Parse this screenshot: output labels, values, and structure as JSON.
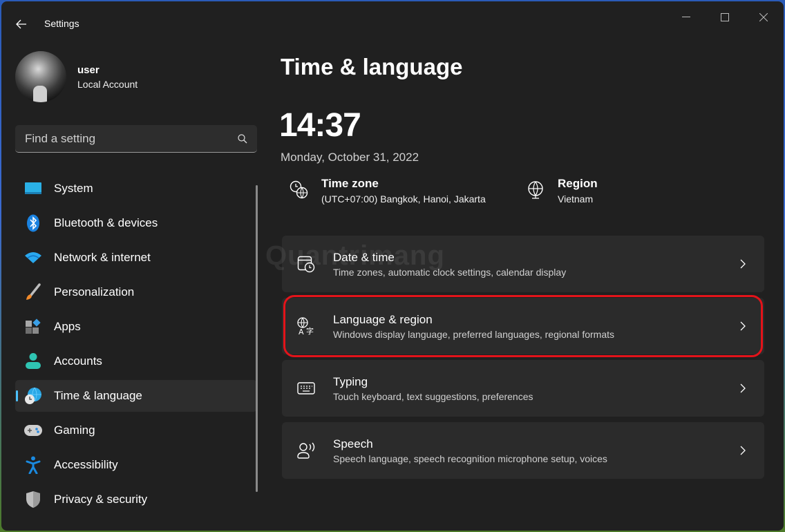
{
  "window": {
    "title": "Settings",
    "controls": {
      "minimize": "Minimize",
      "maximize": "Maximize",
      "close": "Close"
    }
  },
  "profile": {
    "name": "user",
    "account_type": "Local Account"
  },
  "search": {
    "placeholder": "Find a setting",
    "value": ""
  },
  "sidebar": {
    "items": [
      {
        "label": "System",
        "icon": "system-icon"
      },
      {
        "label": "Bluetooth & devices",
        "icon": "bluetooth-icon"
      },
      {
        "label": "Network & internet",
        "icon": "wifi-icon"
      },
      {
        "label": "Personalization",
        "icon": "brush-icon"
      },
      {
        "label": "Apps",
        "icon": "apps-icon"
      },
      {
        "label": "Accounts",
        "icon": "account-icon"
      },
      {
        "label": "Time & language",
        "icon": "time-language-icon",
        "active": true
      },
      {
        "label": "Gaming",
        "icon": "gamepad-icon"
      },
      {
        "label": "Accessibility",
        "icon": "accessibility-icon"
      },
      {
        "label": "Privacy & security",
        "icon": "shield-icon"
      }
    ]
  },
  "main": {
    "title": "Time & language",
    "clock": "14:37",
    "date": "Monday, October 31, 2022",
    "time_zone": {
      "title": "Time zone",
      "value": "(UTC+07:00) Bangkok, Hanoi, Jakarta"
    },
    "region": {
      "title": "Region",
      "value": "Vietnam"
    },
    "cards": [
      {
        "title": "Date & time",
        "description": "Time zones, automatic clock settings, calendar display",
        "icon": "calendar-clock-icon"
      },
      {
        "title": "Language & region",
        "description": "Windows display language, preferred languages, regional formats",
        "icon": "language-icon",
        "highlighted": true
      },
      {
        "title": "Typing",
        "description": "Touch keyboard, text suggestions, preferences",
        "icon": "keyboard-icon"
      },
      {
        "title": "Speech",
        "description": "Speech language, speech recognition microphone setup, voices",
        "icon": "speech-icon"
      }
    ],
    "watermark": "Quantrimang"
  },
  "colors": {
    "accent": "#4cc2ff",
    "highlight": "#e3131a",
    "background": "#202020",
    "card": "#2b2b2b"
  }
}
